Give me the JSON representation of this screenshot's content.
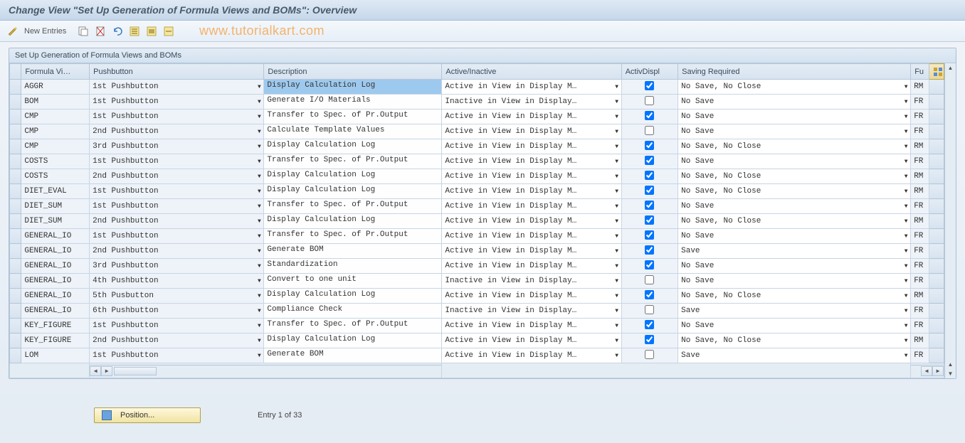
{
  "title": "Change View \"Set Up Generation of Formula Views and BOMs\": Overview",
  "toolbar": {
    "new_entries": "New Entries"
  },
  "watermark": "www.tutorialkart.com",
  "panel_title": "Set Up Generation of Formula Views and BOMs",
  "columns": {
    "formula_view": "Formula Vi…",
    "pushbutton": "Pushbutton",
    "description": "Description",
    "active_inactive": "Active/Inactive",
    "activ_displ": "ActivDispl",
    "saving_required": "Saving Required",
    "fu": "Fu"
  },
  "rows": [
    {
      "fv": "AGGR",
      "pb": "1st Pushbutton",
      "desc": "Display Calculation Log",
      "ai": "Active in View in Display M…",
      "ad": true,
      "sr": "No Save, No Close",
      "fu": "RM",
      "sel": true
    },
    {
      "fv": "BOM",
      "pb": "1st Pushbutton",
      "desc": "Generate I/O Materials",
      "ai": "Inactive in View in Display…",
      "ad": false,
      "sr": "No Save",
      "fu": "FR"
    },
    {
      "fv": "CMP",
      "pb": "1st Pushbutton",
      "desc": "Transfer to Spec. of Pr.Output",
      "ai": "Active in View in Display M…",
      "ad": true,
      "sr": "No Save",
      "fu": "FR"
    },
    {
      "fv": "CMP",
      "pb": "2nd Pushbutton",
      "desc": "Calculate Template Values",
      "ai": "Active in View in Display M…",
      "ad": false,
      "sr": "No Save",
      "fu": "FR"
    },
    {
      "fv": "CMP",
      "pb": "3rd Pushbutton",
      "desc": "Display Calculation Log",
      "ai": "Active in View in Display M…",
      "ad": true,
      "sr": "No Save, No Close",
      "fu": "RM"
    },
    {
      "fv": "COSTS",
      "pb": "1st Pushbutton",
      "desc": "Transfer to Spec. of Pr.Output",
      "ai": "Active in View in Display M…",
      "ad": true,
      "sr": "No Save",
      "fu": "FR"
    },
    {
      "fv": "COSTS",
      "pb": "2nd Pushbutton",
      "desc": "Display Calculation Log",
      "ai": "Active in View in Display M…",
      "ad": true,
      "sr": "No Save, No Close",
      "fu": "RM"
    },
    {
      "fv": "DIET_EVAL",
      "pb": "1st Pushbutton",
      "desc": "Display Calculation Log",
      "ai": "Active in View in Display M…",
      "ad": true,
      "sr": "No Save, No Close",
      "fu": "RM"
    },
    {
      "fv": "DIET_SUM",
      "pb": "1st Pushbutton",
      "desc": "Transfer to Spec. of Pr.Output",
      "ai": "Active in View in Display M…",
      "ad": true,
      "sr": "No Save",
      "fu": "FR"
    },
    {
      "fv": "DIET_SUM",
      "pb": "2nd Pushbutton",
      "desc": "Display Calculation Log",
      "ai": "Active in View in Display M…",
      "ad": true,
      "sr": "No Save, No Close",
      "fu": "RM"
    },
    {
      "fv": "GENERAL_IO",
      "pb": "1st Pushbutton",
      "desc": "Transfer to Spec. of Pr.Output",
      "ai": "Active in View in Display M…",
      "ad": true,
      "sr": "No Save",
      "fu": "FR"
    },
    {
      "fv": "GENERAL_IO",
      "pb": "2nd Pushbutton",
      "desc": "Generate BOM",
      "ai": "Active in View in Display M…",
      "ad": true,
      "sr": "Save",
      "fu": "FR"
    },
    {
      "fv": "GENERAL_IO",
      "pb": "3rd Pushbutton",
      "desc": "Standardization",
      "ai": "Active in View in Display M…",
      "ad": true,
      "sr": "No Save",
      "fu": "FR"
    },
    {
      "fv": "GENERAL_IO",
      "pb": "4th Pushbutton",
      "desc": "Convert to one unit",
      "ai": "Inactive in View in Display…",
      "ad": false,
      "sr": "No Save",
      "fu": "FR"
    },
    {
      "fv": "GENERAL_IO",
      "pb": "5th Pusbutton",
      "desc": "Display Calculation Log",
      "ai": "Active in View in Display M…",
      "ad": true,
      "sr": "No Save, No Close",
      "fu": "RM"
    },
    {
      "fv": "GENERAL_IO",
      "pb": "6th Pushbutton",
      "desc": "Compliance Check",
      "ai": "Inactive in View in Display…",
      "ad": false,
      "sr": "Save",
      "fu": "FR"
    },
    {
      "fv": "KEY_FIGURE",
      "pb": "1st Pushbutton",
      "desc": "Transfer to Spec. of Pr.Output",
      "ai": "Active in View in Display M…",
      "ad": true,
      "sr": "No Save",
      "fu": "FR"
    },
    {
      "fv": "KEY_FIGURE",
      "pb": "2nd Pushbutton",
      "desc": "Display Calculation Log",
      "ai": "Active in View in Display M…",
      "ad": true,
      "sr": "No Save, No Close",
      "fu": "RM"
    },
    {
      "fv": "LOM",
      "pb": "1st Pushbutton",
      "desc": "Generate BOM",
      "ai": "Active in View in Display M…",
      "ad": false,
      "sr": "Save",
      "fu": "FR"
    }
  ],
  "footer": {
    "position_label": "Position...",
    "entry_info": "Entry 1 of 33"
  }
}
